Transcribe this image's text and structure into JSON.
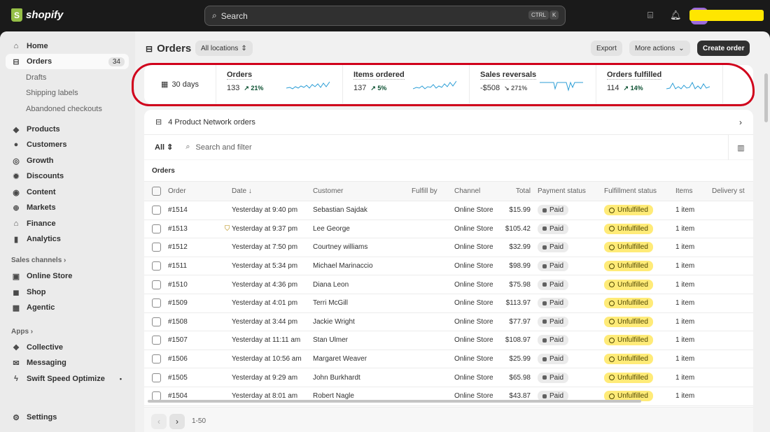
{
  "brand": {
    "name": "shopify"
  },
  "search": {
    "placeholder": "Search",
    "shortcut_ctrl": "CTRL",
    "shortcut_key": "K"
  },
  "sidebar": {
    "home": "Home",
    "orders": "Orders",
    "orders_count": "34",
    "drafts": "Drafts",
    "shipping_labels": "Shipping labels",
    "abandoned": "Abandoned checkouts",
    "products": "Products",
    "customers": "Customers",
    "growth": "Growth",
    "discounts": "Discounts",
    "content": "Content",
    "markets": "Markets",
    "finance": "Finance",
    "analytics": "Analytics",
    "sales_channels": "Sales channels",
    "online_store": "Online Store",
    "shop": "Shop",
    "agentic": "Agentic",
    "apps": "Apps",
    "collective": "Collective",
    "messaging": "Messaging",
    "swift": "Swift Speed Optimize",
    "settings": "Settings"
  },
  "header": {
    "title": "Orders",
    "locations": "All locations",
    "export": "Export",
    "more_actions": "More actions",
    "create_order": "Create order"
  },
  "metrics": {
    "period": "30 days",
    "items": [
      {
        "label": "Orders",
        "value": "133",
        "change": "↗ 21%"
      },
      {
        "label": "Items ordered",
        "value": "137",
        "change": "↗ 5%"
      },
      {
        "label": "Sales reversals",
        "value": "-$508",
        "change": "↘ 271%"
      },
      {
        "label": "Orders fulfilled",
        "value": "114",
        "change": "↗ 14%"
      }
    ]
  },
  "product_network": "4 Product Network orders",
  "filter": {
    "all": "All",
    "placeholder": "Search and filter"
  },
  "table": {
    "heading": "Orders",
    "columns": [
      "Order",
      "Date ↓",
      "Customer",
      "Fulfill by",
      "Channel",
      "Total",
      "Payment status",
      "Fulfillment status",
      "Items",
      "Delivery st"
    ],
    "rows": [
      {
        "order": "#1514",
        "date": "Yesterday at 9:40 pm",
        "customer": "Sebastian Sajdak",
        "channel": "Online Store",
        "total": "$15.99",
        "payment": "Paid",
        "fulfillment": "Unfulfilled",
        "items": "1 item"
      },
      {
        "order": "#1513",
        "date": "Yesterday at 9:37 pm",
        "customer": "Lee George",
        "channel": "Online Store",
        "total": "$105.42",
        "payment": "Paid",
        "fulfillment": "Unfulfilled",
        "items": "1 item"
      },
      {
        "order": "#1512",
        "date": "Yesterday at 7:50 pm",
        "customer": "Courtney williams",
        "channel": "Online Store",
        "total": "$32.99",
        "payment": "Paid",
        "fulfillment": "Unfulfilled",
        "items": "1 item"
      },
      {
        "order": "#1511",
        "date": "Yesterday at 5:34 pm",
        "customer": "Michael Marinaccio",
        "channel": "Online Store",
        "total": "$98.99",
        "payment": "Paid",
        "fulfillment": "Unfulfilled",
        "items": "1 item"
      },
      {
        "order": "#1510",
        "date": "Yesterday at 4:36 pm",
        "customer": "Diana Leon",
        "channel": "Online Store",
        "total": "$75.98",
        "payment": "Paid",
        "fulfillment": "Unfulfilled",
        "items": "1 item"
      },
      {
        "order": "#1509",
        "date": "Yesterday at 4:01 pm",
        "customer": "Terri McGill",
        "channel": "Online Store",
        "total": "$113.97",
        "payment": "Paid",
        "fulfillment": "Unfulfilled",
        "items": "1 item"
      },
      {
        "order": "#1508",
        "date": "Yesterday at 3:44 pm",
        "customer": "Jackie Wright",
        "channel": "Online Store",
        "total": "$77.97",
        "payment": "Paid",
        "fulfillment": "Unfulfilled",
        "items": "1 item"
      },
      {
        "order": "#1507",
        "date": "Yesterday at 11:11 am",
        "customer": "Stan Ulmer",
        "channel": "Online Store",
        "total": "$108.97",
        "payment": "Paid",
        "fulfillment": "Unfulfilled",
        "items": "1 item"
      },
      {
        "order": "#1506",
        "date": "Yesterday at 10:56 am",
        "customer": "Margaret Weaver",
        "channel": "Online Store",
        "total": "$25.99",
        "payment": "Paid",
        "fulfillment": "Unfulfilled",
        "items": "1 item"
      },
      {
        "order": "#1505",
        "date": "Yesterday at 9:29 am",
        "customer": "John Burkhardt",
        "channel": "Online Store",
        "total": "$65.98",
        "payment": "Paid",
        "fulfillment": "Unfulfilled",
        "items": "1 item"
      },
      {
        "order": "#1504",
        "date": "Yesterday at 8:01 am",
        "customer": "Robert Nagle",
        "channel": "Online Store",
        "total": "$43.87",
        "payment": "Paid",
        "fulfillment": "Unfulfilled",
        "items": "1 item"
      }
    ]
  },
  "pagination": {
    "range": "1-50"
  },
  "colors": {
    "annotation": "#d0011b",
    "unfulfilled": "#ffeb78",
    "sparkline": "#2c9ed6"
  }
}
